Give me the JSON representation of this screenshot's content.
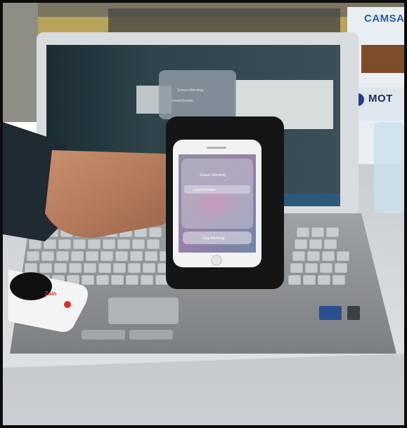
{
  "scene": {
    "banner": {
      "text_1": "CAMSA",
      "text_2": "MOT"
    },
    "laptop_mirror_panel": {
      "title": "Screen Mirroring",
      "device": "LonelyScreen"
    },
    "phone": {
      "panel_title": "Screen Mirroring",
      "device_name": "LonelyScreen",
      "stop_button": "Stop Mirroring"
    },
    "router": {
      "brand": "Zain"
    }
  }
}
